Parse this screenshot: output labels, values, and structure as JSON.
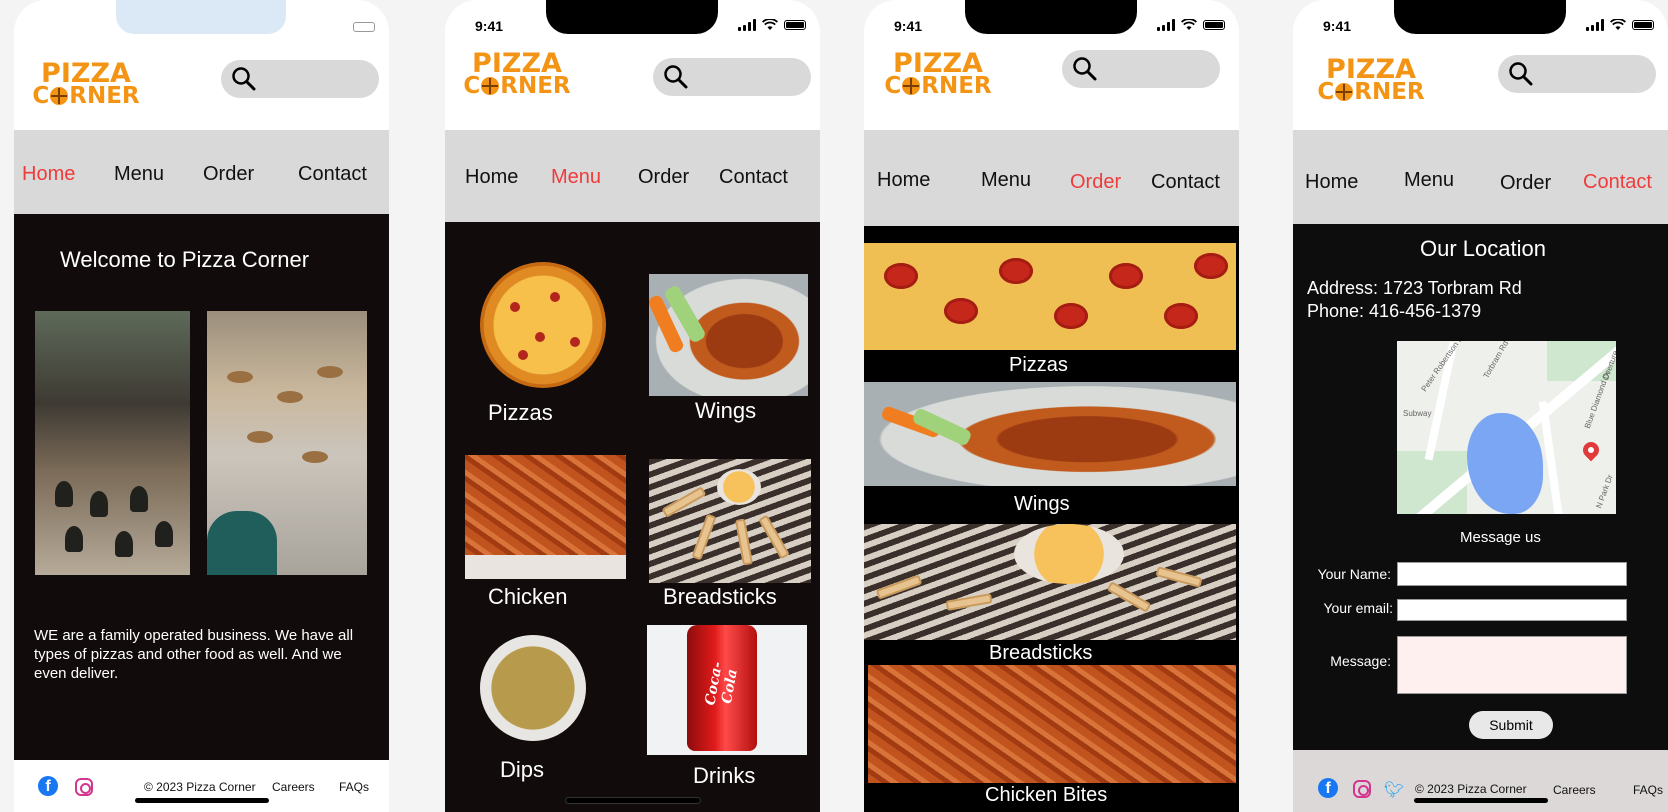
{
  "status": {
    "time": "9:41"
  },
  "brand": {
    "line1": "PIZZA",
    "line2_pre": "C",
    "line2_post": "RNER"
  },
  "nav": {
    "home": "Home",
    "menu": "Menu",
    "order": "Order",
    "contact": "Contact"
  },
  "colors": {
    "accent": "#ef3b3b",
    "brand": "#f39415",
    "dark_bg": "#120b0b",
    "nav_bg": "#d9d9d9"
  },
  "home": {
    "title": "Welcome to Pizza Corner",
    "about": "WE are a family operated business. We have all types of pizzas and other food as well. And we even deliver."
  },
  "menu_items": [
    "Pizzas",
    "Wings",
    "Chicken",
    "Breadsticks",
    "Dips",
    "Drinks"
  ],
  "order_items": [
    "Pizzas",
    "Wings",
    "Breadsticks",
    "Chicken Bites"
  ],
  "contact": {
    "title": "Our Location",
    "address": "Address: 1723 Torbram Rd",
    "phone": "Phone: 416-456-1379",
    "message_us": "Message us",
    "name_label": "Your Name:",
    "email_label": "Your email:",
    "message_label": "Message:",
    "submit": "Submit",
    "map_labels": [
      "Peter Robertson Blvd",
      "Torbram Rd",
      "Subway",
      "Blue Diamond Dr",
      "Overture",
      "N Park Dr"
    ]
  },
  "footer": {
    "copyright": "© 2023 Pizza Corner",
    "careers": "Careers",
    "faqs": "FAQs"
  },
  "icons": [
    "search-icon",
    "facebook-icon",
    "instagram-icon",
    "twitter-icon",
    "signal-icon",
    "wifi-icon",
    "battery-icon",
    "map-pin-icon"
  ]
}
